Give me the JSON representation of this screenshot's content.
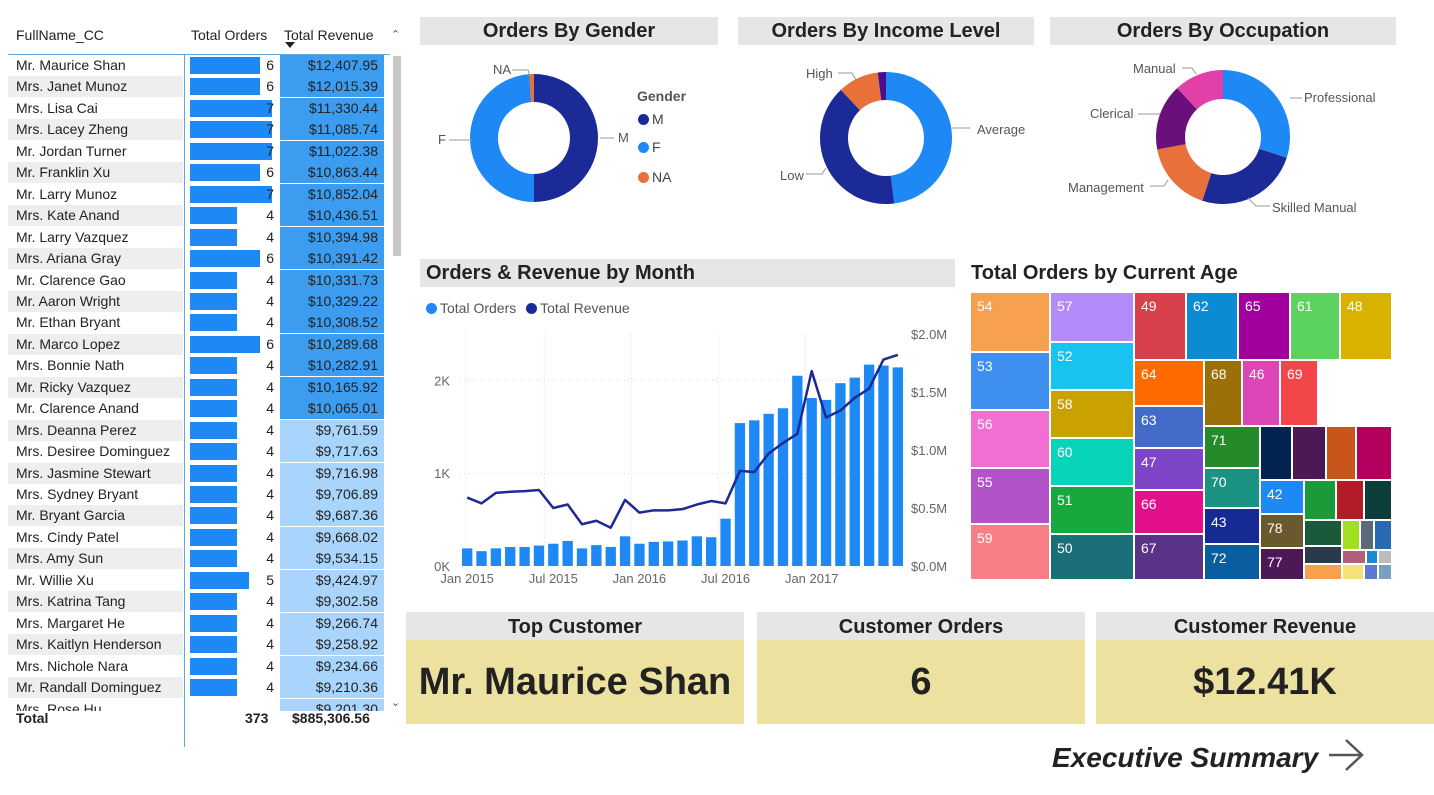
{
  "table": {
    "headers": {
      "name": "FullName_CC",
      "orders": "Total Orders",
      "revenue": "Total Revenue"
    },
    "rows": [
      {
        "name": "Mr. Maurice Shan",
        "orders": 6,
        "revenue": "$12,407.95"
      },
      {
        "name": "Mrs. Janet Munoz",
        "orders": 6,
        "revenue": "$12,015.39"
      },
      {
        "name": "Mrs. Lisa Cai",
        "orders": 7,
        "revenue": "$11,330.44"
      },
      {
        "name": "Mrs. Lacey Zheng",
        "orders": 7,
        "revenue": "$11,085.74"
      },
      {
        "name": "Mr. Jordan Turner",
        "orders": 7,
        "revenue": "$11,022.38"
      },
      {
        "name": "Mr. Franklin Xu",
        "orders": 6,
        "revenue": "$10,863.44"
      },
      {
        "name": "Mr. Larry Munoz",
        "orders": 7,
        "revenue": "$10,852.04"
      },
      {
        "name": "Mrs. Kate Anand",
        "orders": 4,
        "revenue": "$10,436.51"
      },
      {
        "name": "Mr. Larry Vazquez",
        "orders": 4,
        "revenue": "$10,394.98"
      },
      {
        "name": "Mrs. Ariana Gray",
        "orders": 6,
        "revenue": "$10,391.42"
      },
      {
        "name": "Mr. Clarence Gao",
        "orders": 4,
        "revenue": "$10,331.73"
      },
      {
        "name": "Mr. Aaron Wright",
        "orders": 4,
        "revenue": "$10,329.22"
      },
      {
        "name": "Mr. Ethan Bryant",
        "orders": 4,
        "revenue": "$10,308.52"
      },
      {
        "name": "Mr. Marco Lopez",
        "orders": 6,
        "revenue": "$10,289.68"
      },
      {
        "name": "Mrs. Bonnie Nath",
        "orders": 4,
        "revenue": "$10,282.91"
      },
      {
        "name": "Mr. Ricky Vazquez",
        "orders": 4,
        "revenue": "$10,165.92"
      },
      {
        "name": "Mr. Clarence Anand",
        "orders": 4,
        "revenue": "$10,065.01"
      },
      {
        "name": "Mrs. Deanna Perez",
        "orders": 4,
        "revenue": "$9,761.59"
      },
      {
        "name": "Mrs. Desiree Dominguez",
        "orders": 4,
        "revenue": "$9,717.63"
      },
      {
        "name": "Mrs. Jasmine Stewart",
        "orders": 4,
        "revenue": "$9,716.98"
      },
      {
        "name": "Mrs. Sydney Bryant",
        "orders": 4,
        "revenue": "$9,706.89"
      },
      {
        "name": "Mr. Bryant Garcia",
        "orders": 4,
        "revenue": "$9,687.36"
      },
      {
        "name": "Mrs. Cindy Patel",
        "orders": 4,
        "revenue": "$9,668.02"
      },
      {
        "name": "Mrs. Amy Sun",
        "orders": 4,
        "revenue": "$9,534.15"
      },
      {
        "name": "Mr. Willie Xu",
        "orders": 5,
        "revenue": "$9,424.97"
      },
      {
        "name": "Mrs. Katrina Tang",
        "orders": 4,
        "revenue": "$9,302.58"
      },
      {
        "name": "Mrs. Margaret He",
        "orders": 4,
        "revenue": "$9,266.74"
      },
      {
        "name": "Mrs. Kaitlyn Henderson",
        "orders": 4,
        "revenue": "$9,258.92"
      },
      {
        "name": "Mrs. Nichole Nara",
        "orders": 4,
        "revenue": "$9,234.66"
      },
      {
        "name": "Mr. Randall Dominguez",
        "orders": 4,
        "revenue": "$9,210.36"
      },
      {
        "name": "Mrs. Rose Hu",
        "orders": "",
        "revenue": "$9,201.30"
      }
    ],
    "total": {
      "label": "Total",
      "orders": "373",
      "revenue": "$885,306.56"
    },
    "bar_color": "#1e88f5",
    "revenue_bg_strong": "#3c9cf0",
    "revenue_bg_light": "#a9d4fb",
    "highlight_rows": 17
  },
  "gender": {
    "title": "Orders By Gender",
    "legend_title": "Gender",
    "slices": [
      {
        "label": "M",
        "value": 0.5,
        "color": "#1b2a96"
      },
      {
        "label": "F",
        "value": 0.488,
        "color": "#1e88f5"
      },
      {
        "label": "NA",
        "value": 0.012,
        "color": "#e8703a"
      }
    ]
  },
  "income": {
    "title": "Orders By Income Level",
    "slices": [
      {
        "label": "Average",
        "value": 0.48,
        "color": "#1e88f5"
      },
      {
        "label": "Low",
        "value": 0.4,
        "color": "#1b2a96"
      },
      {
        "label": "High",
        "value": 0.1,
        "color": "#e8703a"
      },
      {
        "label": "",
        "value": 0.02,
        "color": "#4a0e8f"
      }
    ]
  },
  "occupation": {
    "title": "Orders By Occupation",
    "slices": [
      {
        "label": "Professional",
        "value": 0.3,
        "color": "#1e88f5"
      },
      {
        "label": "Skilled Manual",
        "value": 0.25,
        "color": "#1b2a96"
      },
      {
        "label": "Management",
        "value": 0.17,
        "color": "#e8703a"
      },
      {
        "label": "Clerical",
        "value": 0.16,
        "color": "#6b0f7a"
      },
      {
        "label": "Manual",
        "value": 0.12,
        "color": "#e040a8"
      }
    ]
  },
  "combo": {
    "title": "Orders & Revenue by Month",
    "legend": [
      {
        "name": "Total Orders",
        "color": "#1e88f5"
      },
      {
        "name": "Total Revenue",
        "color": "#1b2a96"
      }
    ]
  },
  "chart_data": {
    "type": "bar",
    "title": "Orders & Revenue by Month",
    "x_tick_labels": [
      "Jan 2015",
      "Jul 2015",
      "Jan 2016",
      "Jul 2016",
      "Jan 2017"
    ],
    "y_left_ticks": [
      "0K",
      "1K",
      "2K"
    ],
    "y_right_ticks": [
      "$0.0M",
      "$0.5M",
      "$1.0M",
      "$1.5M",
      "$2.0M"
    ],
    "ylim_left": [
      0,
      2500
    ],
    "ylim_right": [
      0,
      2000000
    ],
    "categories": [
      "2015-01",
      "2015-02",
      "2015-03",
      "2015-04",
      "2015-05",
      "2015-06",
      "2015-07",
      "2015-08",
      "2015-09",
      "2015-10",
      "2015-11",
      "2015-12",
      "2016-01",
      "2016-02",
      "2016-03",
      "2016-04",
      "2016-05",
      "2016-06",
      "2016-07",
      "2016-08",
      "2016-09",
      "2016-10",
      "2016-11",
      "2016-12",
      "2017-01",
      "2017-02",
      "2017-03",
      "2017-04",
      "2017-05",
      "2017-06",
      "2017-07"
    ],
    "series": [
      {
        "name": "Total Orders",
        "type": "bar",
        "values": [
          190,
          160,
          190,
          205,
          205,
          220,
          240,
          270,
          190,
          225,
          205,
          320,
          240,
          260,
          265,
          275,
          320,
          310,
          510,
          1540,
          1570,
          1640,
          1700,
          2050,
          1810,
          1790,
          1970,
          2030,
          2170,
          2160,
          2140
        ]
      },
      {
        "name": "Total Revenue",
        "type": "line",
        "values": [
          590000,
          540000,
          630000,
          640000,
          645000,
          655000,
          500000,
          530000,
          360000,
          390000,
          330000,
          570000,
          460000,
          480000,
          480000,
          490000,
          530000,
          560000,
          540000,
          820000,
          810000,
          970000,
          1060000,
          1140000,
          1680000,
          1280000,
          1340000,
          1450000,
          1530000,
          1780000,
          1820000
        ]
      }
    ]
  },
  "treemap": {
    "title": "Total Orders by Current Age",
    "cells": [
      {
        "label": "54",
        "color": "#f7a14e"
      },
      {
        "label": "53",
        "color": "#3e8fef"
      },
      {
        "label": "56",
        "color": "#f06fd1"
      },
      {
        "label": "55",
        "color": "#b353c9"
      },
      {
        "label": "59",
        "color": "#f97f86"
      },
      {
        "label": "57",
        "color": "#b28bf9"
      },
      {
        "label": "52",
        "color": "#19c3ef"
      },
      {
        "label": "58",
        "color": "#c9a200"
      },
      {
        "label": "60",
        "color": "#08d4b9"
      },
      {
        "label": "51",
        "color": "#19a83d"
      },
      {
        "label": "50",
        "color": "#196e77"
      },
      {
        "label": "49",
        "color": "#d8414c"
      },
      {
        "label": "62",
        "color": "#0a8bd3"
      },
      {
        "label": "65",
        "color": "#a2009e"
      },
      {
        "label": "61",
        "color": "#5dd35f"
      },
      {
        "label": "48",
        "color": "#d9b200"
      },
      {
        "label": "64",
        "color": "#ff6a00"
      },
      {
        "label": "68",
        "color": "#9b7009"
      },
      {
        "label": "46",
        "color": "#dc46b7"
      },
      {
        "label": "69",
        "color": "#f2464b"
      },
      {
        "label": "63",
        "color": "#446bc9"
      },
      {
        "label": "47",
        "color": "#7f45c9"
      },
      {
        "label": "71",
        "color": "#258a2a"
      },
      {
        "label": "66",
        "color": "#e3108c"
      },
      {
        "label": "70",
        "color": "#1a9382"
      },
      {
        "label": "67",
        "color": "#5a3288"
      },
      {
        "label": "43",
        "color": "#162a96"
      },
      {
        "label": "42",
        "color": "#1e88f5"
      },
      {
        "label": "72",
        "color": "#0b5e9d"
      },
      {
        "label": "78",
        "color": "#69592c"
      },
      {
        "label": "77",
        "color": "#4d1856"
      }
    ]
  },
  "cards": {
    "top_customer": {
      "title": "Top Customer",
      "value": "Mr. Maurice Shan"
    },
    "customer_orders": {
      "title": "Customer Orders",
      "value": "6"
    },
    "customer_revenue": {
      "title": "Customer Revenue",
      "value": "$12.41K"
    }
  },
  "nav": {
    "label": "Executive Summary",
    "icon": "arrow-right-icon"
  }
}
